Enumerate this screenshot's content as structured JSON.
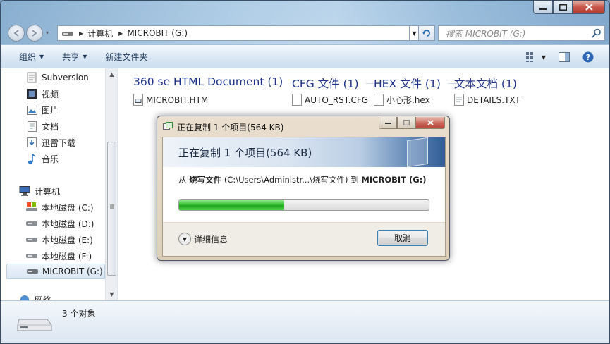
{
  "address": {
    "root": "计算机",
    "drive": "MICROBIT (G:)"
  },
  "search": {
    "placeholder": "搜索 MICROBIT (G:)"
  },
  "toolbar": {
    "organize": "组织",
    "share": "共享",
    "new_folder": "新建文件夹"
  },
  "sidebar": {
    "items": [
      {
        "label": "Subversion",
        "icon": "subversion-folder-icon"
      },
      {
        "label": "视频",
        "icon": "video-library-icon"
      },
      {
        "label": "图片",
        "icon": "picture-library-icon"
      },
      {
        "label": "文档",
        "icon": "document-library-icon"
      },
      {
        "label": "迅雷下载",
        "icon": "thunder-download-icon"
      },
      {
        "label": "音乐",
        "icon": "music-library-icon"
      }
    ],
    "computer": "计算机",
    "drives": [
      {
        "label": "本地磁盘 (C:)"
      },
      {
        "label": "本地磁盘 (D:)"
      },
      {
        "label": "本地磁盘 (E:)"
      },
      {
        "label": "本地磁盘 (F:)"
      },
      {
        "label": "MICROBIT (G:)",
        "selected": true
      }
    ],
    "network_partial": "网络"
  },
  "groups": [
    {
      "header": "360 se HTML Document (1)",
      "file": "MICROBIT.HTM"
    },
    {
      "header": "CFG 文件 (1)",
      "file": "AUTO_RST.CFG"
    },
    {
      "header": "HEX 文件 (1)",
      "file": "小心形.hex"
    },
    {
      "header": "文本文档 (1)",
      "file": "DETAILS.TXT"
    }
  ],
  "status": {
    "text": "3 个对象"
  },
  "dialog": {
    "title": "正在复制 1 个项目(564 KB)",
    "heading": "正在复制 1 个项目(564 KB)",
    "from_word": "从",
    "source_name": "烧写文件",
    "source_path": "(C:\\Users\\Administr...\\烧写文件)",
    "to_word": "到",
    "dest": "MICROBIT (G:)",
    "progress": 0.42,
    "details": "详细信息",
    "cancel": "取消"
  }
}
